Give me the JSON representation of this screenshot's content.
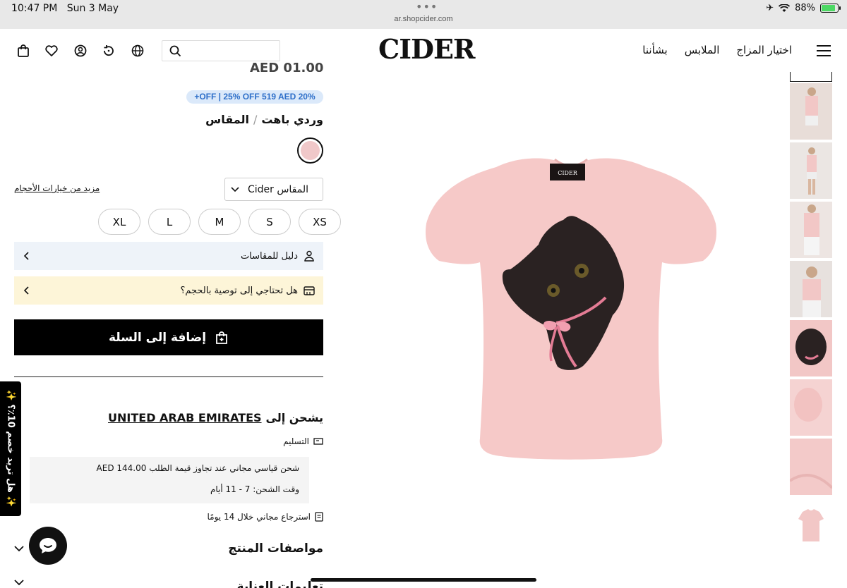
{
  "status": {
    "time": "10:47 PM",
    "date": "Sun 3 May",
    "url": "ar.shopcider.com",
    "battery": "88%",
    "battery_level": 0.88
  },
  "header": {
    "logo": "CIDER",
    "search_placeholder": "",
    "nav": [
      "اختيار المزاج",
      "الملابس",
      "بشأننا"
    ]
  },
  "product": {
    "price_partial": "AED 01.00",
    "promo": "+OFF | 25% OFF 519 AED 20%",
    "color_label": "المقاس",
    "color_sep": "/",
    "color_value": "وردي باهت",
    "swatch_color": "#f0c8c9",
    "size_select": "Cider المقاس",
    "more_sizes": "مزيد من خيارات الأحجام",
    "sizes": [
      "XS",
      "S",
      "M",
      "L",
      "XL"
    ],
    "size_guide": "دليل للمقاسات",
    "size_rec": "هل تحتاجي إلى توصية بالحجم؟",
    "add_to_cart": "إضافة إلى السلة"
  },
  "shipping": {
    "ship_to": "يشحن إلى",
    "country": "UNITED ARAB EMIRATES",
    "delivery": "التسليم",
    "free_shipping": "شحن قياسي مجاني عند تجاوز قيمة الطلب AED 144.00",
    "ship_time": "وقت الشحن: 7 - 11 أيام",
    "returns": "استرجاع مجاني خلال 14 يومًا"
  },
  "sections": {
    "specs": "مواصفات المنتج",
    "care": "تعليمات العناية"
  },
  "side_tab": "✨ هل تريد خصم 10٪؟ ✨",
  "colors": {
    "shirt": "#f6c9c8",
    "accent_blue": "#2e6fc9",
    "promo_bg": "#dbe9fa",
    "guide_bg": "#eef3f9",
    "rec_bg": "#fdf5d8"
  }
}
